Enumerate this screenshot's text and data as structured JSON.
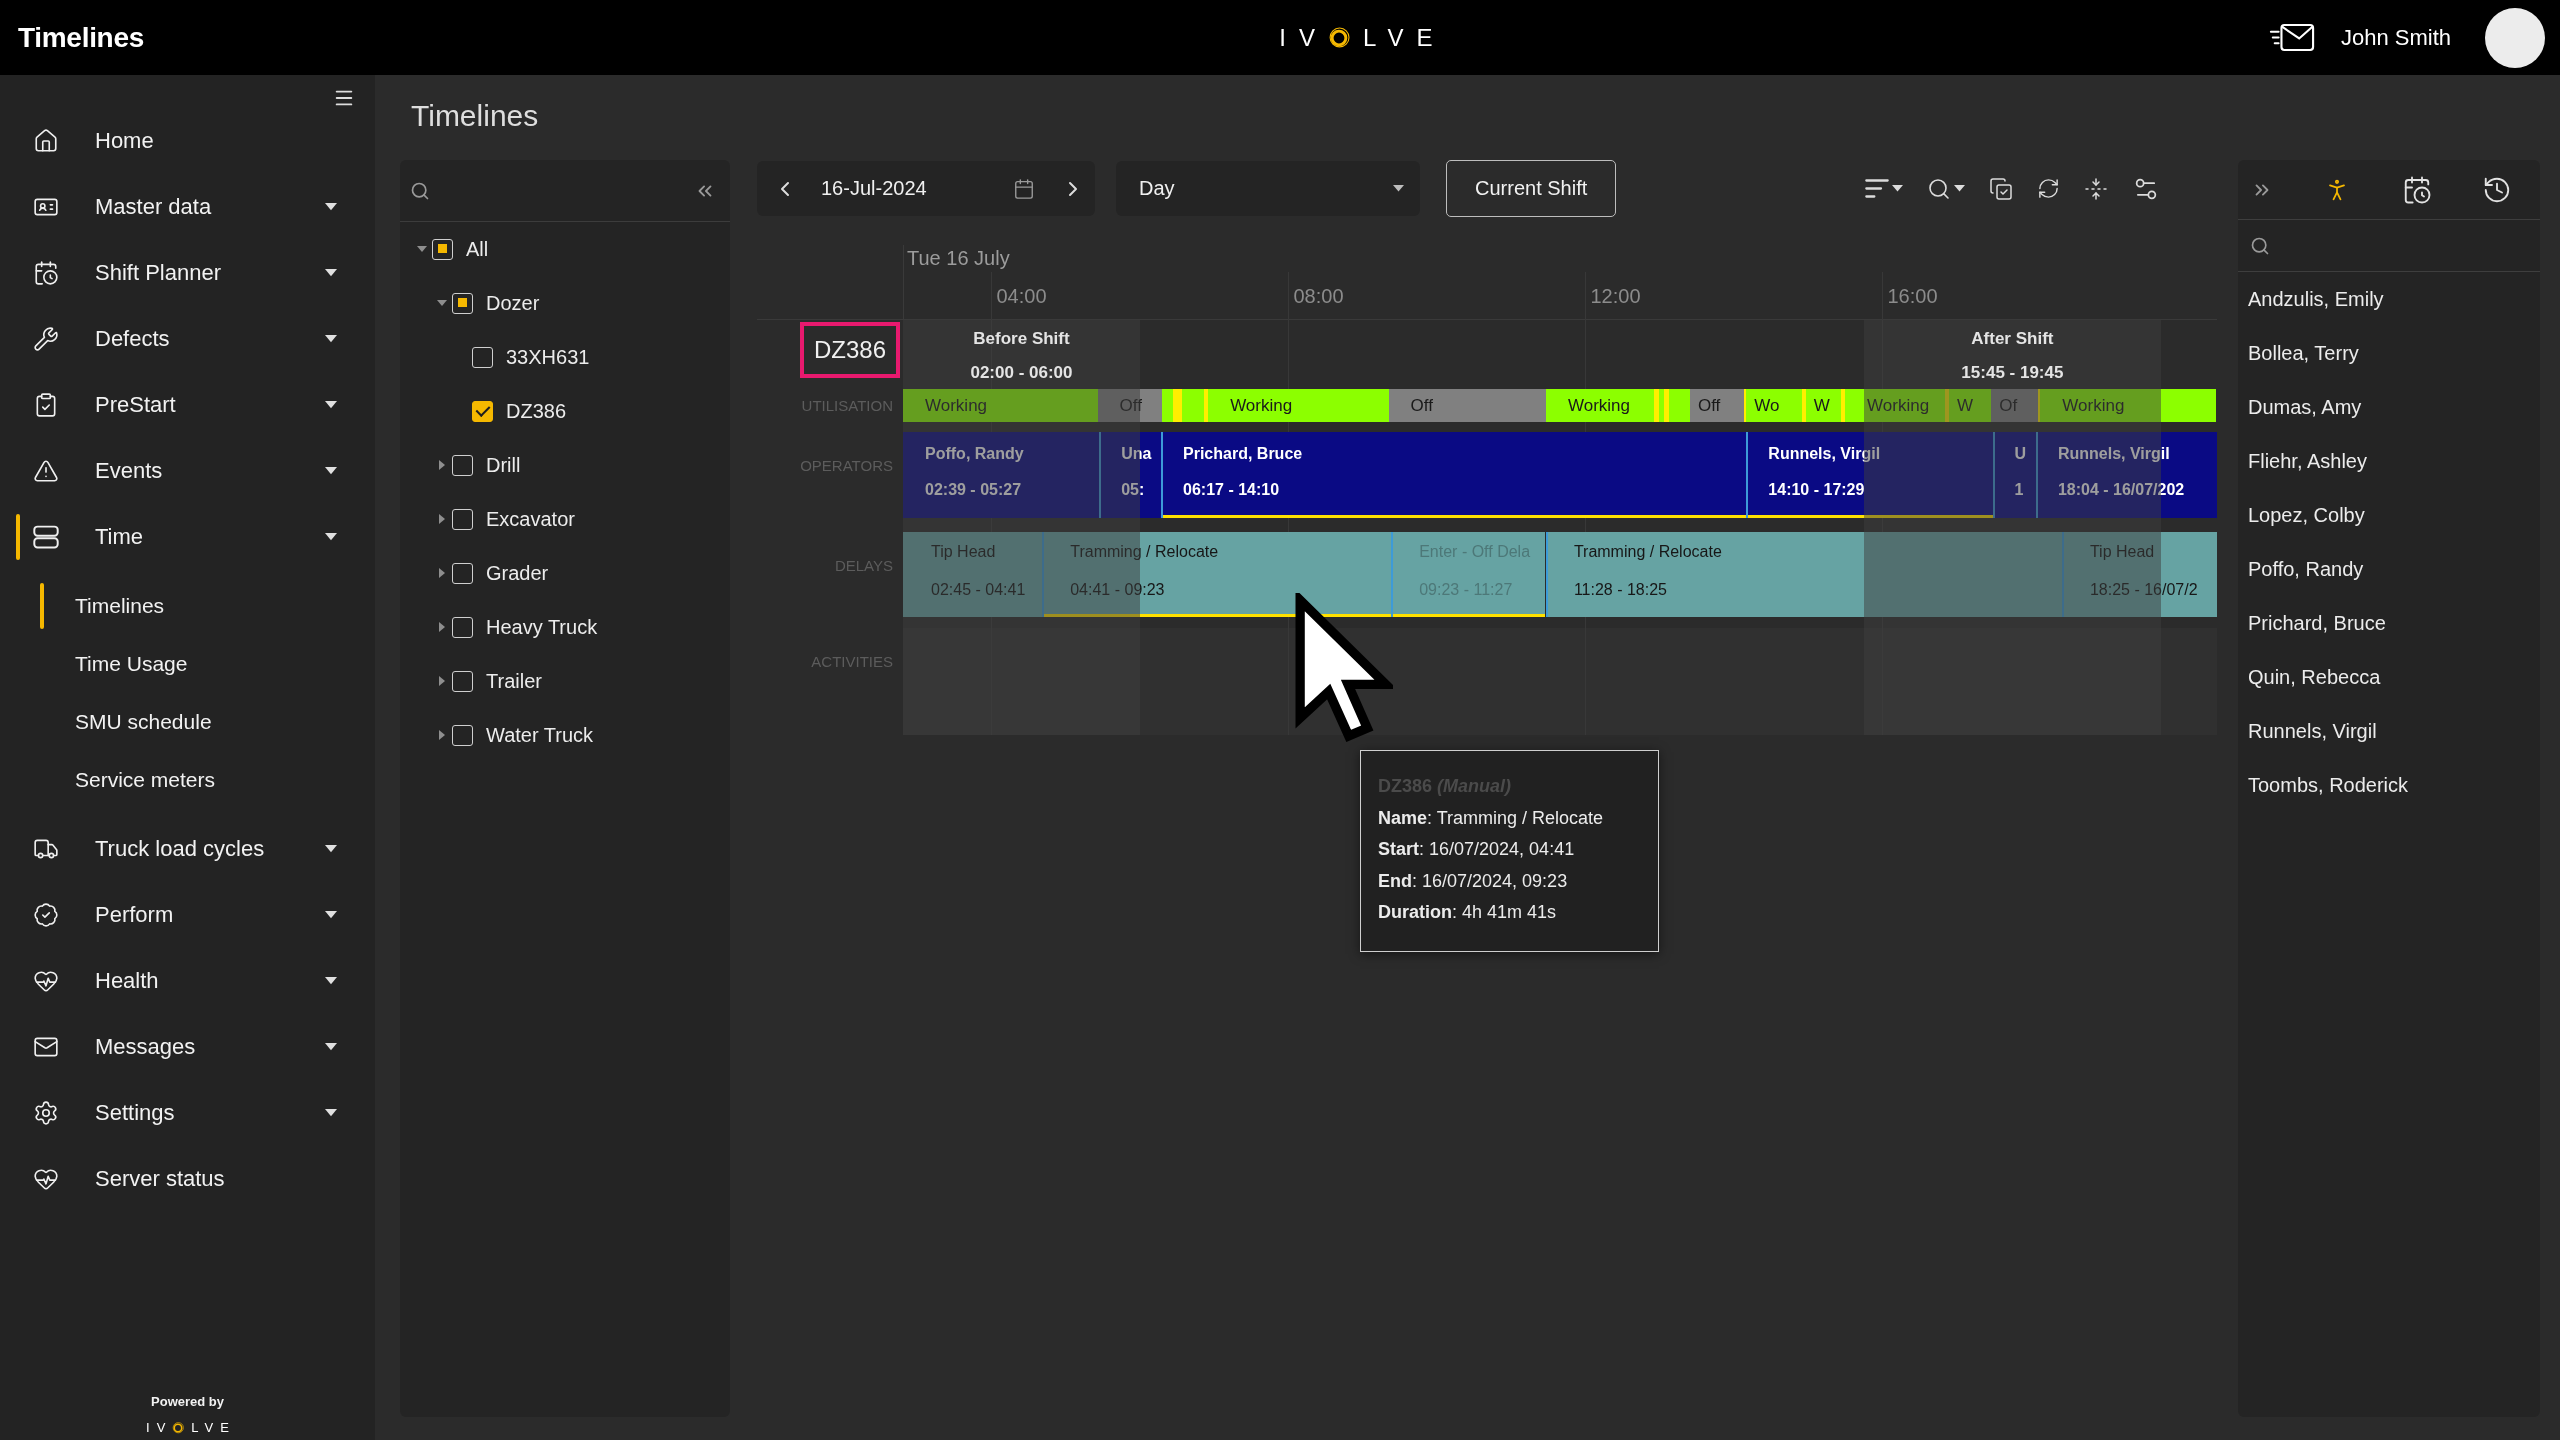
{
  "app_bar": {
    "title": "Timelines",
    "logo": {
      "left": "IV",
      "right": "LVE"
    },
    "user_name": "John Smith"
  },
  "sidebar": {
    "items": [
      {
        "label": "Home",
        "kind": "link",
        "selected": false
      },
      {
        "label": "Master data",
        "kind": "group",
        "selected": false
      },
      {
        "label": "Shift Planner",
        "kind": "group",
        "selected": false
      },
      {
        "label": "Defects",
        "kind": "group",
        "selected": false
      },
      {
        "label": "PreStart",
        "kind": "group",
        "selected": false
      },
      {
        "label": "Events",
        "kind": "group",
        "selected": false
      },
      {
        "label": "Time",
        "kind": "group",
        "selected": true,
        "children": [
          {
            "label": "Timelines",
            "selected": true
          },
          {
            "label": "Time Usage",
            "selected": false
          },
          {
            "label": "SMU schedule",
            "selected": false
          },
          {
            "label": "Service meters",
            "selected": false
          }
        ]
      },
      {
        "label": "Truck load cycles",
        "kind": "group",
        "selected": false
      },
      {
        "label": "Perform",
        "kind": "group",
        "selected": false
      },
      {
        "label": "Health",
        "kind": "group",
        "selected": false
      },
      {
        "label": "Messages",
        "kind": "group",
        "selected": false
      },
      {
        "label": "Settings",
        "kind": "group",
        "selected": false
      },
      {
        "label": "Server status",
        "kind": "link",
        "selected": false
      }
    ],
    "footer": {
      "caption": "Powered by",
      "logo": {
        "left": "IV",
        "right": "LVE"
      }
    }
  },
  "page": {
    "title": "Timelines"
  },
  "equipment_tree": {
    "items": [
      {
        "label": "All",
        "expanded": true,
        "checked": false,
        "indeterminate": true,
        "children": [
          {
            "label": "Dozer",
            "expanded": true,
            "checked": false,
            "indeterminate": true,
            "children": [
              {
                "label": "33XH631",
                "checked": false,
                "indeterminate": false
              },
              {
                "label": "DZ386",
                "checked": true,
                "indeterminate": false
              }
            ]
          },
          {
            "label": "Drill",
            "expanded": false,
            "checked": false,
            "indeterminate": false
          },
          {
            "label": "Excavator",
            "expanded": false,
            "checked": false,
            "indeterminate": false
          },
          {
            "label": "Grader",
            "expanded": false,
            "checked": false,
            "indeterminate": false
          },
          {
            "label": "Heavy Truck",
            "expanded": false,
            "checked": false,
            "indeterminate": false
          },
          {
            "label": "Trailer",
            "expanded": false,
            "checked": false,
            "indeterminate": false
          },
          {
            "label": "Water Truck",
            "expanded": false,
            "checked": false,
            "indeterminate": false
          }
        ]
      }
    ]
  },
  "toolbar": {
    "date": "16-Jul-2024",
    "period": "Day",
    "shift_button": "Current Shift"
  },
  "timeline": {
    "date_label": "Tue 16 July",
    "ticks": [
      "04:00",
      "08:00",
      "12:00",
      "16:00"
    ],
    "equipment": "DZ386",
    "shifts": [
      {
        "name": "Before Shift",
        "time": "02:00 - 06:00"
      },
      {
        "name": "After Shift",
        "time": "15:45 - 19:45"
      }
    ],
    "rows": [
      {
        "label": "UTILISATION",
        "kind": "utilisation",
        "segments": [
          {
            "kind": "working",
            "label": "Working"
          },
          {
            "kind": "off",
            "label": "Off"
          },
          {
            "kind": "working"
          },
          {
            "kind": "event"
          },
          {
            "kind": "working"
          },
          {
            "kind": "event"
          },
          {
            "kind": "working",
            "label": "Working"
          },
          {
            "kind": "off",
            "label": "Off"
          },
          {
            "kind": "working",
            "label": "Working"
          },
          {
            "kind": "event"
          },
          {
            "kind": "working"
          },
          {
            "kind": "event"
          },
          {
            "kind": "working"
          },
          {
            "kind": "off",
            "label": "Off"
          },
          {
            "kind": "event"
          },
          {
            "kind": "working",
            "label": "Wo"
          },
          {
            "kind": "event"
          },
          {
            "kind": "working",
            "label": "W"
          },
          {
            "kind": "event"
          },
          {
            "kind": "working",
            "label": "Working"
          },
          {
            "kind": "event"
          },
          {
            "kind": "working",
            "label": "W"
          },
          {
            "kind": "off",
            "label": "Of"
          },
          {
            "kind": "event"
          },
          {
            "kind": "working",
            "label": "Working"
          }
        ]
      },
      {
        "label": "OPERATORS",
        "kind": "operators",
        "bars": [
          {
            "name": "Poffo, Randy",
            "time": "02:39 - 05:27",
            "manual": false
          },
          {
            "name": "Una",
            "time": "05:",
            "manual": false
          },
          {
            "name": "Prichard, Bruce",
            "time": "06:17 - 14:10",
            "manual": true
          },
          {
            "name": "Runnels, Virgil",
            "time": "14:10 - 17:29",
            "manual": true
          },
          {
            "name": "U",
            "time": "1",
            "manual": false
          },
          {
            "name": "Runnels, Virgil",
            "time": "18:04 - 16/07/202",
            "manual": false
          }
        ]
      },
      {
        "label": "DELAYS",
        "kind": "delays",
        "bars": [
          {
            "name": "Tip Head",
            "time": "02:45 - 04:41",
            "manual": false,
            "muted": false
          },
          {
            "name": "Tramming / Relocate",
            "time": "04:41 - 09:23",
            "manual": true,
            "muted": false
          },
          {
            "name": "Enter - Off Dela",
            "time": "09:23 - 11:27",
            "manual": true,
            "muted": true
          },
          {
            "name": "Tramming / Relocate",
            "time": "11:28 - 18:25",
            "manual": false,
            "muted": false
          },
          {
            "name": "Tip Head",
            "time": "18:25 - 16/07/2",
            "manual": false,
            "muted": false
          }
        ]
      },
      {
        "label": "ACTIVITIES",
        "kind": "activities"
      }
    ]
  },
  "tooltip": {
    "title": "DZ386 *(Manual)*",
    "lines": [
      "**Name**: Tramming / Relocate",
      "**Start**: 16/07/2024, 04:41",
      "**End**: 16/07/2024, 09:23",
      "**Duration**: 4h 41m 41s"
    ]
  },
  "operators_panel": {
    "tabs": [
      {
        "selected": true
      },
      {
        "selected": false
      },
      {
        "selected": false
      }
    ],
    "names": [
      "Andzulis, Emily",
      "Bollea, Terry",
      "Dumas, Amy",
      "Fliehr, Ashley",
      "Lopez, Colby",
      "Poffo, Randy",
      "Prichard, Bruce",
      "Quin, Rebecca",
      "Runnels, Virgil",
      "Toombs, Roderick"
    ]
  }
}
